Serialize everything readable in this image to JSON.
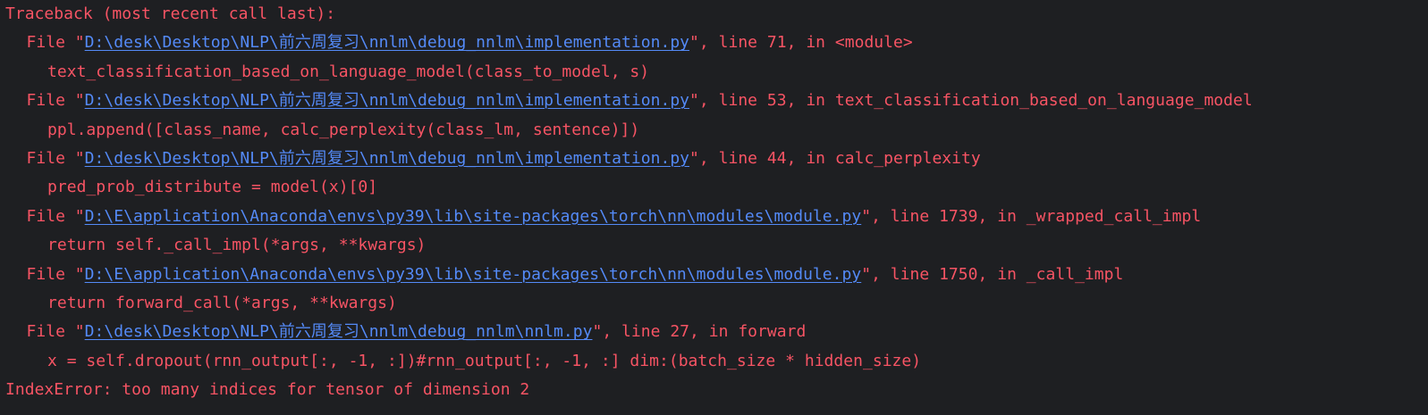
{
  "console": {
    "header": "Traceback (most recent call last):",
    "frames": [
      {
        "file_prefix": "File \"",
        "path": "D:\\desk\\Desktop\\NLP\\前六周复习\\nnlm\\debug_nnlm\\implementation.py",
        "file_suffix": "\", line 71, in <module>",
        "code": "text_classification_based_on_language_model(class_to_model, s)"
      },
      {
        "file_prefix": "File \"",
        "path": "D:\\desk\\Desktop\\NLP\\前六周复习\\nnlm\\debug_nnlm\\implementation.py",
        "file_suffix": "\", line 53, in text_classification_based_on_language_model",
        "code": "ppl.append([class_name, calc_perplexity(class_lm, sentence)])"
      },
      {
        "file_prefix": "File \"",
        "path": "D:\\desk\\Desktop\\NLP\\前六周复习\\nnlm\\debug_nnlm\\implementation.py",
        "file_suffix": "\", line 44, in calc_perplexity",
        "code": "pred_prob_distribute = model(x)[0]"
      },
      {
        "file_prefix": "File \"",
        "path": "D:\\E\\application\\Anaconda\\envs\\py39\\lib\\site-packages\\torch\\nn\\modules\\module.py",
        "file_suffix": "\", line 1739, in _wrapped_call_impl",
        "code": "return self._call_impl(*args, **kwargs)"
      },
      {
        "file_prefix": "File \"",
        "path": "D:\\E\\application\\Anaconda\\envs\\py39\\lib\\site-packages\\torch\\nn\\modules\\module.py",
        "file_suffix": "\", line 1750, in _call_impl",
        "code": "return forward_call(*args, **kwargs)"
      },
      {
        "file_prefix": "File \"",
        "path": "D:\\desk\\Desktop\\NLP\\前六周复习\\nnlm\\debug_nnlm\\nnlm.py",
        "file_suffix": "\", line 27, in forward",
        "code": "x = self.dropout(rnn_output[:, -1, :])#rnn_output[:, -1, :] dim:(batch_size * hidden_size)"
      }
    ],
    "error": "IndexError: too many indices for tensor of dimension 2"
  },
  "colors": {
    "background": "#1e1f22",
    "error_text": "#f75464",
    "link": "#548af7"
  }
}
